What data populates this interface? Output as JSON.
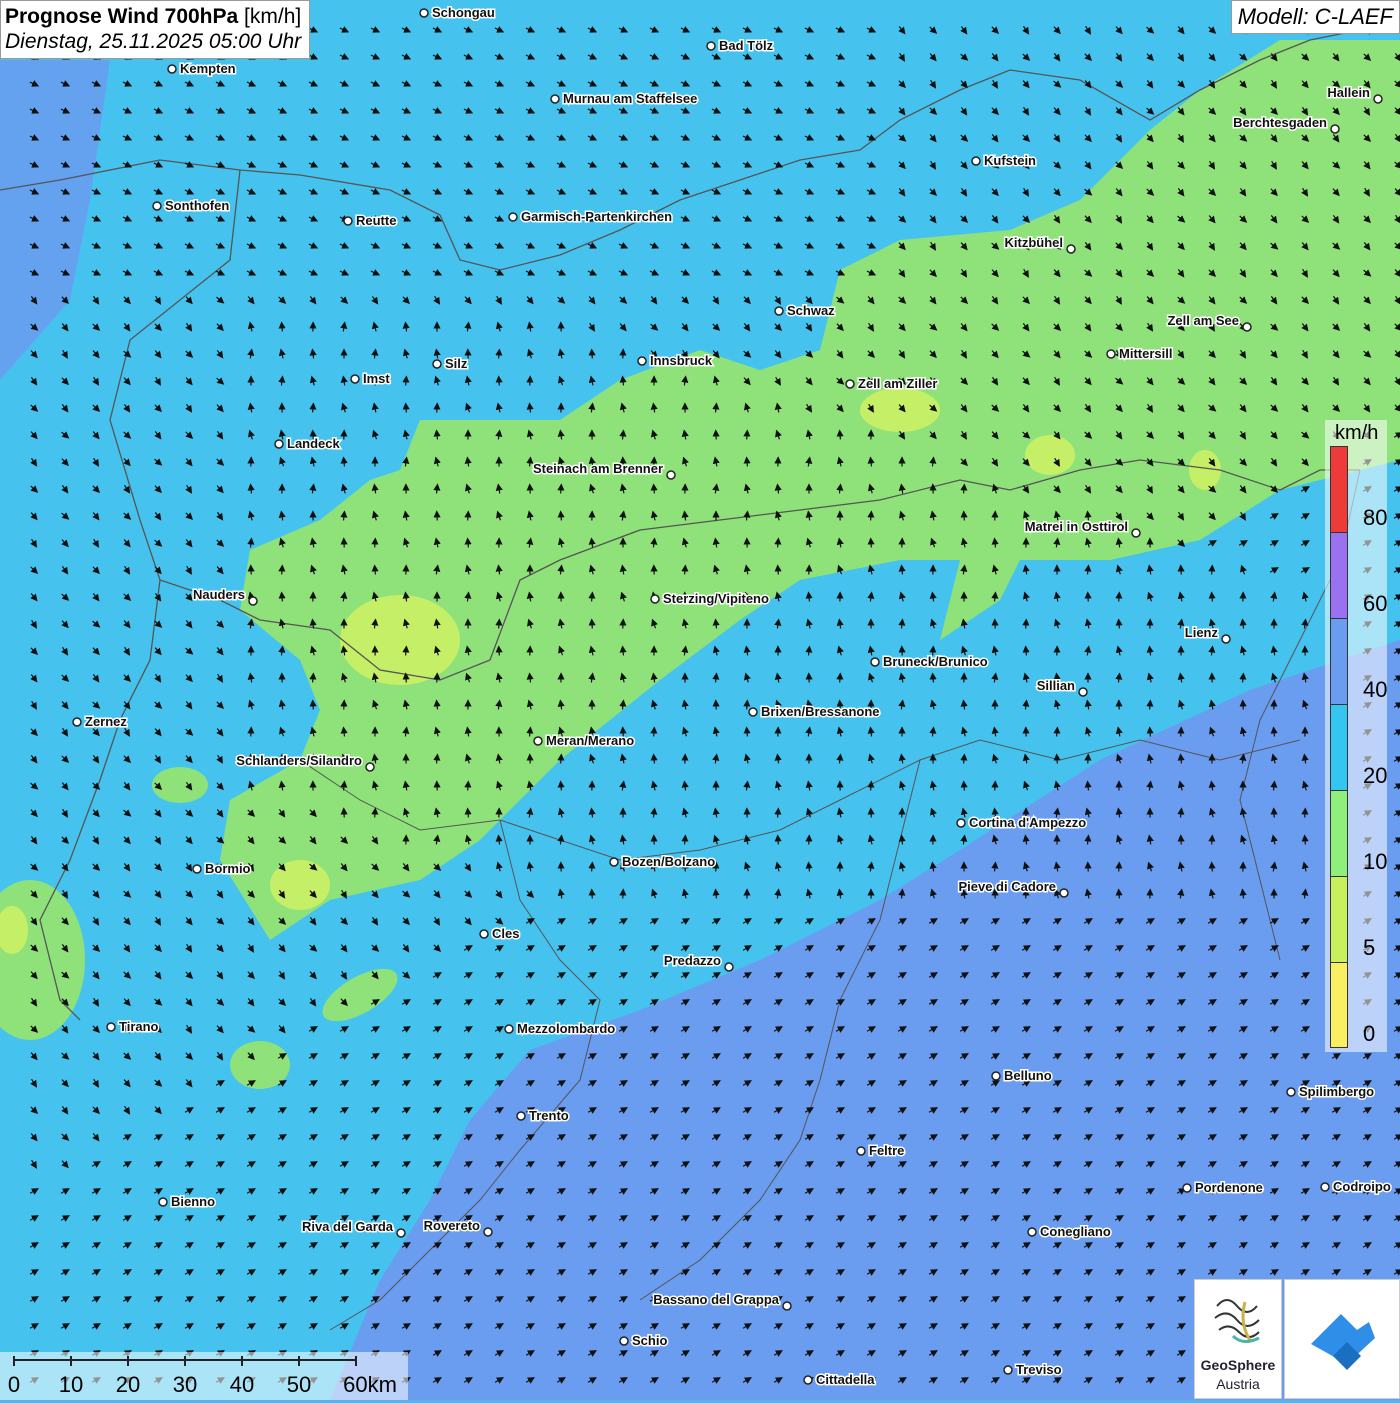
{
  "header": {
    "title_bold": "Prognose Wind 700hPa",
    "title_unit": "[km/h]",
    "date": "Dienstag, 25.11.2025 05:00 Uhr",
    "model": "Modell: C-LAEF"
  },
  "legend": {
    "unit": "km/h",
    "labels": [
      "80",
      "60",
      "40",
      "20",
      "10",
      "5",
      "0"
    ],
    "colors": [
      "#ef3a3a",
      "#9a72f0",
      "#6a9cf0",
      "#34c5f0",
      "#8ef07a",
      "#c8f05a",
      "#f8f060"
    ]
  },
  "scale_bar": {
    "labels": [
      "0",
      "10",
      "20",
      "30",
      "40",
      "50",
      "60km"
    ]
  },
  "map_colors": {
    "band_5_10": "#c6ef68",
    "band_10_20": "#8fe27a",
    "band_20_40": "#45c3ee",
    "band_40_60": "#6a9cf0",
    "arrows": "#111111",
    "borders": "#555555"
  },
  "cities": [
    "Schongau",
    "Bad Tölz",
    "Kempten",
    "Murnau am Staffelsee",
    "Hallein",
    "Berchtesgaden",
    "Kufstein",
    "Sonthofen",
    "Reutte",
    "Garmisch-Partenkirchen",
    "Kitzbühel",
    "Schwaz",
    "Zell am See",
    "Mittersill",
    "Innsbruck",
    "Silz",
    "Imst",
    "Zell am Ziller",
    "Landeck",
    "Steinach am Brenner",
    "Matrei in Osttirol",
    "Nauders",
    "Sterzing/Vipiteno",
    "Lienz",
    "Bruneck/Brunico",
    "Sillian",
    "Brixen/Bressanone",
    "Zernez",
    "Meran/Merano",
    "Schlanders/Silandro",
    "Cortina d'Ampezzo",
    "Bormio",
    "Bozen/Bolzano",
    "Pieve di Cadore",
    "Cles",
    "Predazzo",
    "Tirano",
    "Mezzolombardo",
    "Belluno",
    "Spilimbergo",
    "Trento",
    "Feltre",
    "Pordenone",
    "Codroipo",
    "Bienno",
    "Riva del Garda",
    "Rovereto",
    "Conegliano",
    "Bassano del Grappa",
    "Schio",
    "Treviso",
    "Cittadella"
  ],
  "logos": {
    "geosphere_line1": "GeoSphere",
    "geosphere_line2": "Austria"
  }
}
